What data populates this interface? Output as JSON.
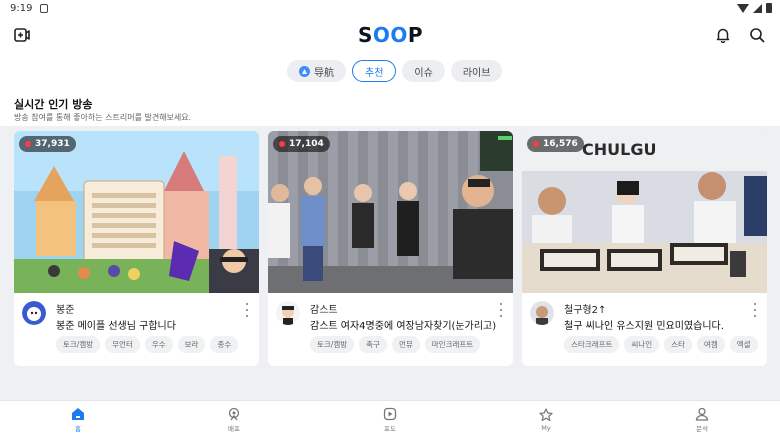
{
  "status_bar": {
    "time": "9:19"
  },
  "app": {
    "logo": "SOOP",
    "logo_prefix": "S",
    "logo_mid": "OO",
    "logo_suffix": "P",
    "accent": "#1b7bf0"
  },
  "tabs": [
    {
      "label": "导航",
      "active": false
    },
    {
      "label": "추천",
      "active": true
    },
    {
      "label": "이슈",
      "active": false
    },
    {
      "label": "라이브",
      "active": false
    }
  ],
  "section": {
    "title": "실시간 인기 방송",
    "subtitle": "방송 참여를 통해 좋아하는 스트리머를 발견해보세요."
  },
  "cards": [
    {
      "viewers": "37,931",
      "streamer": "봉준",
      "title": "봉준 메이플 선생님 구합니다",
      "tags": [
        "토크/캠방",
        "무언터",
        "우수",
        "보라",
        "종수"
      ]
    },
    {
      "viewers": "17,104",
      "streamer": "감스트",
      "title": "감스트 여자4명중에 여장남자찾기(눈가리고)",
      "tags": [
        "토크/캠방",
        "축구",
        "먼뮤",
        "마인크래프트"
      ]
    },
    {
      "viewers": "16,576",
      "streamer": "철구형2↑",
      "title": "철구 씨나인 유스지원 민요미였습니다.",
      "tags": [
        "스타크래프트",
        "씨나인",
        "스타",
        "여캠",
        "액셜"
      ],
      "thumb_text": "CHULGU"
    }
  ],
  "bottom_nav": [
    {
      "label": "홈",
      "icon": "home-icon",
      "active": true
    },
    {
      "label": "배포",
      "icon": "broadcast-icon",
      "active": false
    },
    {
      "label": "포도",
      "icon": "play-icon",
      "active": false
    },
    {
      "label": "My",
      "icon": "star-icon",
      "active": false
    },
    {
      "label": "문석",
      "icon": "person-icon",
      "active": false
    }
  ]
}
